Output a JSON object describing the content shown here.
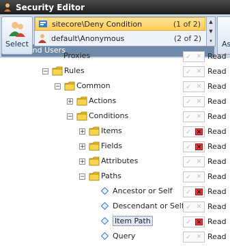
{
  "window": {
    "title": "Security Editor"
  },
  "ribbon": {
    "select_label": "Select",
    "group_label": "Roles and Users",
    "assign_label": "As",
    "accounts": [
      {
        "name": "sitecore\\Deny Condition",
        "count": "(1 of 2)",
        "kind": "role",
        "selected": true
      },
      {
        "name": "default\\Anonymous",
        "count": "(2 of 2)",
        "kind": "user",
        "selected": false
      }
    ]
  },
  "tree": {
    "read_label": "Read",
    "partial_top": "Proxies",
    "items": [
      {
        "label": "Rules",
        "type": "folder",
        "expanded": true,
        "deny": false
      },
      {
        "label": "Common",
        "type": "folder",
        "expanded": true,
        "deny": false
      },
      {
        "label": "Actions",
        "type": "folder",
        "expanded": false,
        "deny": false
      },
      {
        "label": "Conditions",
        "type": "folder",
        "expanded": true,
        "deny": false
      },
      {
        "label": "Items",
        "type": "folder",
        "expanded": false,
        "deny": true
      },
      {
        "label": "Fields",
        "type": "folder",
        "expanded": false,
        "deny": true
      },
      {
        "label": "Attributes",
        "type": "folder",
        "expanded": false,
        "deny": false
      },
      {
        "label": "Paths",
        "type": "folder",
        "expanded": true,
        "deny": false
      },
      {
        "label": "Ancestor or Self",
        "type": "item",
        "deny": true
      },
      {
        "label": "Descendant or Self",
        "type": "item",
        "deny": false
      },
      {
        "label": "Item Path",
        "type": "item",
        "deny": true,
        "selected": true
      },
      {
        "label": "Query",
        "type": "item",
        "deny": false
      }
    ]
  }
}
